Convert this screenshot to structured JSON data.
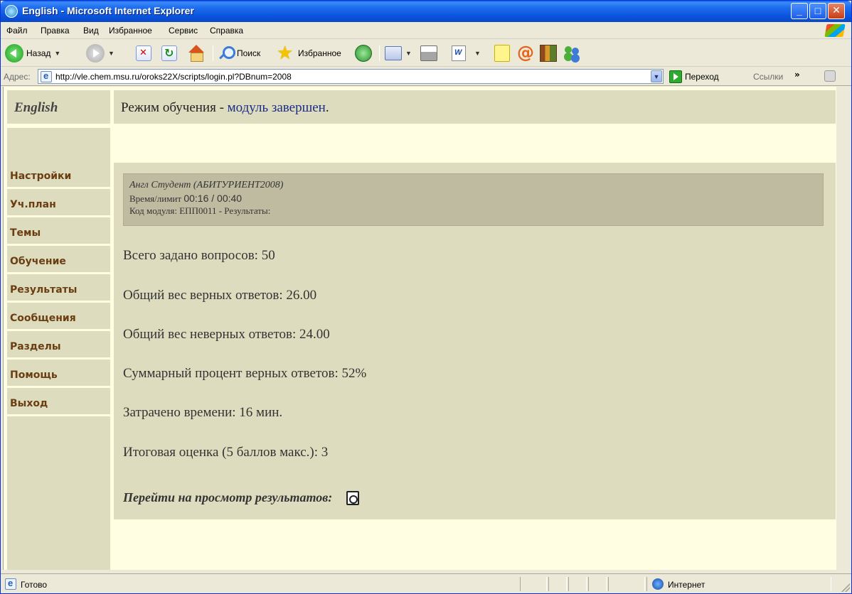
{
  "window": {
    "title": "English - Microsoft Internet Explorer",
    "buttons": {
      "minimize": "_",
      "maximize": "□",
      "close": "✕"
    }
  },
  "menu": [
    "Файл",
    "Правка",
    "Вид",
    "Избранное",
    "Сервис",
    "Справка"
  ],
  "toolbar": {
    "back_label": "Назад",
    "search_label": "Поиск",
    "favorites_label": "Избранное"
  },
  "address": {
    "label": "Адрес:",
    "url": "http://vle.chem.msu.ru/oroks22X/scripts/login.pl?DBnum=2008",
    "go_label": "Переход",
    "links_label": "Ссылки",
    "links_more": "»"
  },
  "sidebar": {
    "title": "English",
    "items": [
      {
        "label": "Настройки"
      },
      {
        "label": "Уч.план"
      },
      {
        "label": "Темы"
      },
      {
        "label": "Обучение"
      },
      {
        "label": "Результаты"
      },
      {
        "label": "Сообщения"
      },
      {
        "label": "Разделы"
      },
      {
        "label": "Помощь"
      },
      {
        "label": "Выход"
      }
    ]
  },
  "header": {
    "mode_prefix": "Режим обучения - ",
    "mode_status": "модуль завершен",
    "mode_suffix": "."
  },
  "student": {
    "name": "Англ Студент (АБИТУРИЕНТ2008)",
    "time_label": "Время/лимит ",
    "time_value": "00:16 / 00:40",
    "module_line": "Код модуля: ЕПП0011 - Результаты:"
  },
  "results": {
    "total_questions": "Всего задано вопросов: 50",
    "correct_weight": "Общий вес верных ответов: 26.00",
    "wrong_weight": "Общий вес неверных ответов: 24.00",
    "percent": "Суммарный процент верных ответов: 52%",
    "time_spent": "Затрачено времени: 16 мин.",
    "final_grade": "Итоговая оценка (5 баллов макс.): 3",
    "view_link": "Перейти на просмотр результатов:"
  },
  "statusbar": {
    "text": "Готово",
    "zone": "Интернет"
  },
  "icons": {
    "back": "back-arrow-icon",
    "forward": "forward-arrow-icon",
    "stop": "stop-icon",
    "refresh": "refresh-icon",
    "home": "home-icon",
    "search": "search-icon",
    "favorites": "favorites-star-icon",
    "media": "media-icon",
    "mail": "mail-icon",
    "print": "print-icon",
    "edit": "word-edit-icon",
    "note": "note-icon",
    "messenger": "at-icon",
    "research": "books-icon",
    "contacts": "users-icon",
    "view_results": "view-results-icon"
  },
  "colors": {
    "page_background": "#fffde2",
    "panel_background": "#dedcbe",
    "info_box": "#bfbba1",
    "nav_text": "#6b3e12",
    "mode_status": "#1a2d86"
  }
}
